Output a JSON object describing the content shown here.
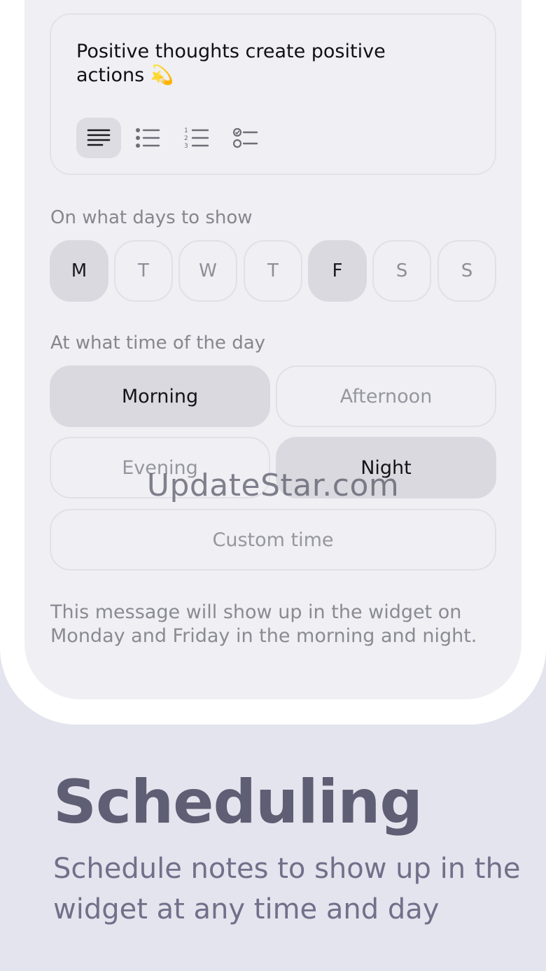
{
  "note": {
    "text": "Positive thoughts create positive actions 💫"
  },
  "format_toolbar": [
    {
      "name": "paragraph-icon",
      "active": true
    },
    {
      "name": "bullet-list-icon",
      "active": false
    },
    {
      "name": "numbered-list-icon",
      "active": false
    },
    {
      "name": "checklist-icon",
      "active": false
    }
  ],
  "days_section": {
    "label": "On what days to show",
    "days": [
      {
        "label": "M",
        "selected": true
      },
      {
        "label": "T",
        "selected": false
      },
      {
        "label": "W",
        "selected": false
      },
      {
        "label": "T",
        "selected": false
      },
      {
        "label": "F",
        "selected": true
      },
      {
        "label": "S",
        "selected": false
      },
      {
        "label": "S",
        "selected": false
      }
    ]
  },
  "time_section": {
    "label": "At what time of the day",
    "options": [
      {
        "label": "Morning",
        "selected": true
      },
      {
        "label": "Afternoon",
        "selected": false
      },
      {
        "label": "Evening",
        "selected": false
      },
      {
        "label": "Night",
        "selected": true
      },
      {
        "label": "Custom time",
        "selected": false
      }
    ]
  },
  "summary": "This message will show up in the widget on Monday and Friday in the morning and night.",
  "watermark": "UpdateStar.com",
  "promo": {
    "title": "Scheduling",
    "subtitle": "Schedule notes to show up in the widget at any time and day"
  },
  "colors": {
    "background": "#e4e4ee",
    "screen": "#efeff4",
    "selected_pill": "#d9d9df",
    "promo_title": "#5e5e74"
  }
}
